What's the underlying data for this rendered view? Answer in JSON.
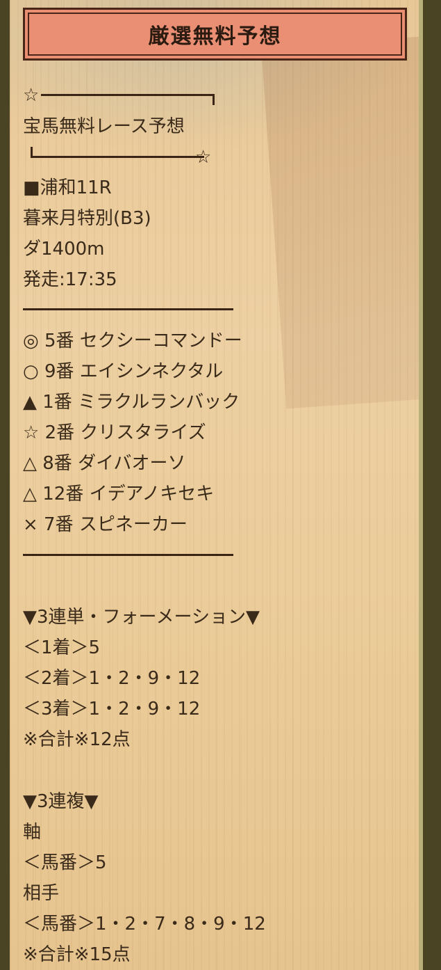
{
  "title": "厳選無料予想",
  "deco": {
    "star_top": "☆",
    "star_bottom": "☆"
  },
  "header_text": "宝馬無料レース予想",
  "race": {
    "venue": "■浦和11R",
    "name": "暮来月特別(B3)",
    "distance": "ダ1400m",
    "start": "発走:17:35"
  },
  "picks": [
    "◎ 5番 セクシーコマンドー",
    "○ 9番 エイシンネクタル",
    "▲ 1番 ミラクルランバック",
    "☆ 2番 クリスタライズ",
    "△ 8番 ダイバオーソ",
    "△ 12番 イデアノキセキ",
    "× 7番 スピネーカー"
  ],
  "trifecta": {
    "heading": "▼3連単・フォーメーション▼",
    "first": "＜1着＞5",
    "second": "＜2着＞1・2・9・12",
    "third": "＜3着＞1・2・9・12",
    "total": "※合計※12点"
  },
  "trio": {
    "heading": "▼3連複▼",
    "axis_label": "軸",
    "axis": "＜馬番＞5",
    "partner_label": "相手",
    "partners": "＜馬番＞1・2・7・8・9・12",
    "total": "※合計※15点"
  },
  "colors": {
    "title_bg": "#ea8f74",
    "title_border": "#4a2618",
    "frame": "#4a4424",
    "wood": "#edd0a3",
    "text": "#3a2a1a"
  }
}
